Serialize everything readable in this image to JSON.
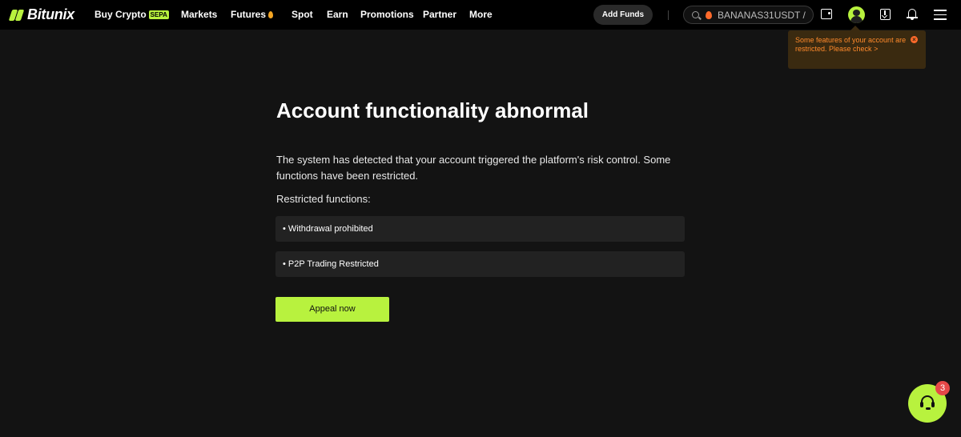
{
  "colors": {
    "accent": "#b8f23e",
    "warning": "#ff8a2b",
    "badge": "#e54848",
    "background": "#131313"
  },
  "header": {
    "logo": "Bitunix",
    "nav": {
      "buy_crypto": "Buy Crypto",
      "sepa_badge": "SEPA",
      "markets": "Markets",
      "futures": "Futures",
      "spot": "Spot",
      "earn": "Earn",
      "promotions": "Promotions",
      "partner": "Partner",
      "more": "More"
    },
    "add_funds": "Add Funds",
    "search_text": "BANANAS31USDT  /",
    "icons": [
      "search-icon",
      "wallet-icon",
      "avatar",
      "download-icon",
      "bell-icon",
      "menu-icon"
    ]
  },
  "tooltip": {
    "text": "Some features of your account are restricted. Please check",
    "arrow": ">"
  },
  "main": {
    "title": "Account functionality abnormal",
    "description": "The system has detected that your account triggered the platform's risk control. Some functions have been restricted.",
    "restricted_label": "Restricted functions:",
    "restrictions": [
      "•  Withdrawal prohibited",
      "•  P2P Trading Restricted"
    ],
    "appeal_button": "Appeal now"
  },
  "support": {
    "badge_count": "3"
  }
}
